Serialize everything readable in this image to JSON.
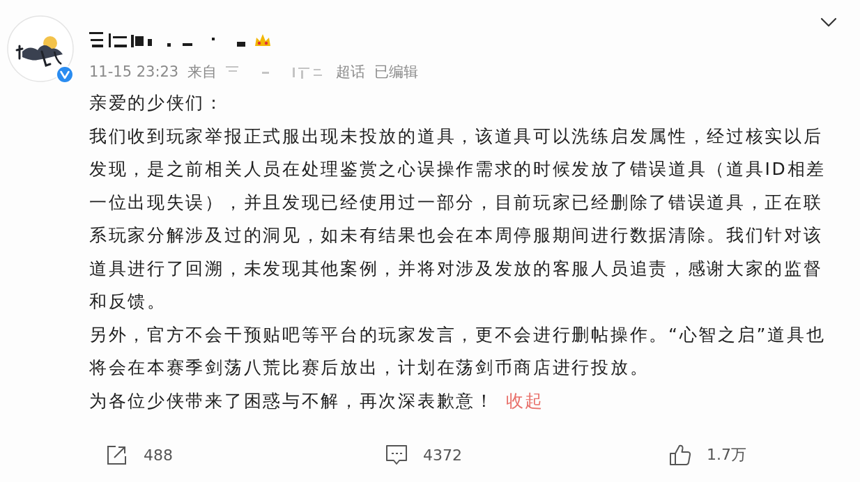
{
  "header": {
    "verified": true,
    "time": "11-15 23:23",
    "source_prefix": "来自",
    "source_suffix": "超话",
    "edited": "已编辑"
  },
  "post": {
    "paragraphs": [
      {
        "text": "亲爱的少侠们："
      },
      {
        "text": "我们收到玩家举报正式服出现未投放的道具，该道具可以洗练启发属性，经过核实以后发现，是之前相关人员在处理鉴赏之心误操作需求的时候发放了错误道具（道具ID相差一位出现失误），并且发现已经使用过一部分，目前玩家已经删除了错误道具，正在联系玩家分解涉及过的洞见，如未有结果也会在本周停服期间进行数据清除。我们针对该道具进行了回溯，未发现其他案例，并将对涉及发放的客服人员追责，感谢大家的监督和反馈。"
      },
      {
        "text": "另外，官方不会干预贴吧等平台的玩家发言，更不会进行删帖操作。“心智之启”道具也将会在本赛季剑荡八荒比赛后放出，计划在荡剑币商店进行投放。"
      },
      {
        "text": "为各位少侠带来了困惑与不解，再次深表歉意！",
        "link": "收起"
      }
    ]
  },
  "actions": [
    {
      "kind": "share",
      "count": "488"
    },
    {
      "kind": "comment",
      "count": "4372"
    },
    {
      "kind": "like",
      "count": "1.7万"
    }
  ]
}
